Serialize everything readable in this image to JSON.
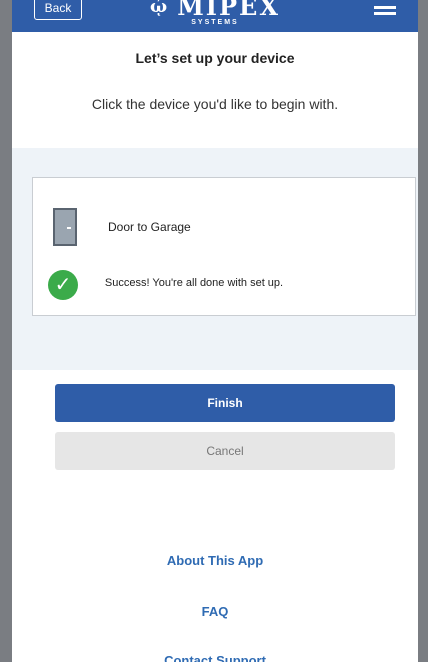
{
  "header": {
    "back_label": "Back",
    "logo_text": "MIPEX",
    "logo_subtext": "SYSTEMS",
    "logo_mark": "῾",
    "menu_icon": "hamburger-icon"
  },
  "page": {
    "title": "Let’s set up your device",
    "subtitle": "Click the device you'd like to begin with."
  },
  "device": {
    "name": "Door to Garage",
    "icon": "door-icon",
    "status_text": "Success! You're all done with set up.",
    "status_icon": "check-circle-icon"
  },
  "buttons": {
    "finish_label": "Finish",
    "cancel_label": "Cancel"
  },
  "footer": {
    "links": [
      "About This App",
      "FAQ",
      "Contact Support"
    ]
  },
  "colors": {
    "brand_blue": "#2f5da8",
    "success_green": "#3bab4a",
    "panel_bg": "#eef3f8",
    "link_blue": "#2f6bb3"
  }
}
